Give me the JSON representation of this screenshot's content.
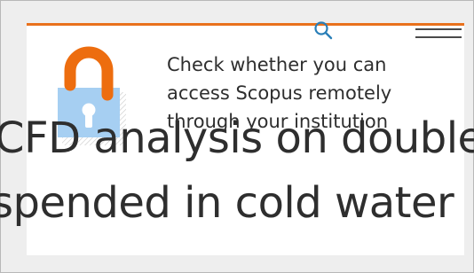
{
  "header": {
    "search_icon": "search-icon",
    "menu_icon": "hamburger-menu-icon",
    "accent_color": "#e9711c"
  },
  "promo": {
    "icon": "unlocked-padlock-icon",
    "line1": "Check whether you can",
    "line2": "access Scopus remotely",
    "line3": "through your institution"
  },
  "article": {
    "title_line1": "CFD analysis on double",
    "title_line2": "spended in cold water"
  }
}
